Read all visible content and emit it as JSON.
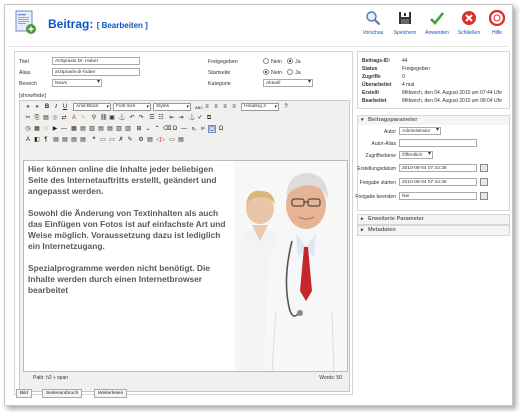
{
  "header": {
    "title": "Beitrag:",
    "subtitle": "[ Bearbeiten ]",
    "toolbar": [
      {
        "label": "Vorschau",
        "icon": "preview-icon"
      },
      {
        "label": "Speichern",
        "icon": "save-icon"
      },
      {
        "label": "Anwenden",
        "icon": "apply-icon"
      },
      {
        "label": "Schließen",
        "icon": "close-icon"
      },
      {
        "label": "Hilfe",
        "icon": "help-icon"
      }
    ]
  },
  "form": {
    "titel_label": "Titel",
    "titel_value": "Arztpraxis Dr. Huber",
    "alias_label": "Alias",
    "alias_value": "arztpraxis-dr-huber",
    "bereich_label": "Bereich",
    "bereich_value": "News",
    "freigegeben_label": "Freigegeben",
    "startseite_label": "Startseite",
    "kategorie_label": "Kategorie",
    "kategorie_value": "Aktuell",
    "nein": "Nein",
    "ja": "Ja"
  },
  "editor": {
    "show_hide": "[show/hide]",
    "font_family": "Arial Black",
    "font_size": "Font size",
    "styles": "Styles",
    "heading": "Heading 2",
    "paragraphs": [
      "Hier können online die Inhalte jeder beliebigen Seite des Internetauftritts erstellt, geändert und angepasst werden.",
      "Sowohl die Änderung von Textinhalten als auch das Einfügen von Fotos ist auf einfachste Art und Weise möglich. Voraussetzung dazu ist lediglich ein Internetzugang.",
      "Spezialprogramme werden nicht benötigt. Die Inhalte werden durch einen Internetbrowser bearbeitet"
    ],
    "path": "Path: h2 » span",
    "words": "Words: 50",
    "buttons": [
      "Bild",
      "Seitenumbruch",
      "Weiterlesen"
    ]
  },
  "info": {
    "rows": [
      {
        "k": "Beitrags-ID:",
        "v": "44"
      },
      {
        "k": "Status",
        "v": "Freigegeben"
      },
      {
        "k": "Zugriffe",
        "v": "0"
      },
      {
        "k": "Überarbeitet",
        "v": "4 mal"
      },
      {
        "k": "Erstellt",
        "v": "Mittwoch, den 04. August 2010 um 07:44 Uhr"
      },
      {
        "k": "Bearbeitet",
        "v": "Mittwoch, den 04. August 2010 um 08:04 Uhr"
      }
    ]
  },
  "params": {
    "heading": "Beitragsparameter",
    "autor_label": "Autor",
    "autor_value": "Administrator",
    "autoralias_label": "Autor-Alias",
    "autoralias_value": "",
    "zugriff_label": "Zugriffsebene",
    "zugriff_value": "Öffentlich",
    "erstellung_label": "Erstellungsdatum",
    "erstellung_value": "2010-08-04 07:44:36",
    "starten_label": "Freigabe starten",
    "starten_value": "2010-08-04 07:44:36",
    "beenden_label": "Freigabe beenden",
    "beenden_value": "Nie",
    "erweitert": "Erweiterte Parameter",
    "metadaten": "Metadaten"
  }
}
